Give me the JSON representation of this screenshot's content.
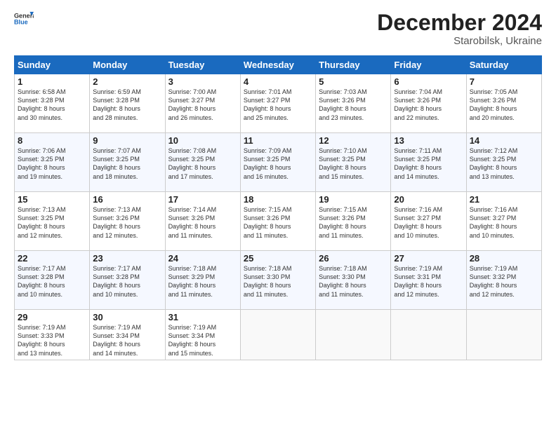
{
  "header": {
    "logo_general": "General",
    "logo_blue": "Blue",
    "month_title": "December 2024",
    "location": "Starobilsk, Ukraine"
  },
  "weekdays": [
    "Sunday",
    "Monday",
    "Tuesday",
    "Wednesday",
    "Thursday",
    "Friday",
    "Saturday"
  ],
  "rows": [
    [
      {
        "day": "1",
        "lines": [
          "Sunrise: 6:58 AM",
          "Sunset: 3:28 PM",
          "Daylight: 8 hours",
          "and 30 minutes."
        ]
      },
      {
        "day": "2",
        "lines": [
          "Sunrise: 6:59 AM",
          "Sunset: 3:28 PM",
          "Daylight: 8 hours",
          "and 28 minutes."
        ]
      },
      {
        "day": "3",
        "lines": [
          "Sunrise: 7:00 AM",
          "Sunset: 3:27 PM",
          "Daylight: 8 hours",
          "and 26 minutes."
        ]
      },
      {
        "day": "4",
        "lines": [
          "Sunrise: 7:01 AM",
          "Sunset: 3:27 PM",
          "Daylight: 8 hours",
          "and 25 minutes."
        ]
      },
      {
        "day": "5",
        "lines": [
          "Sunrise: 7:03 AM",
          "Sunset: 3:26 PM",
          "Daylight: 8 hours",
          "and 23 minutes."
        ]
      },
      {
        "day": "6",
        "lines": [
          "Sunrise: 7:04 AM",
          "Sunset: 3:26 PM",
          "Daylight: 8 hours",
          "and 22 minutes."
        ]
      },
      {
        "day": "7",
        "lines": [
          "Sunrise: 7:05 AM",
          "Sunset: 3:26 PM",
          "Daylight: 8 hours",
          "and 20 minutes."
        ]
      }
    ],
    [
      {
        "day": "8",
        "lines": [
          "Sunrise: 7:06 AM",
          "Sunset: 3:25 PM",
          "Daylight: 8 hours",
          "and 19 minutes."
        ]
      },
      {
        "day": "9",
        "lines": [
          "Sunrise: 7:07 AM",
          "Sunset: 3:25 PM",
          "Daylight: 8 hours",
          "and 18 minutes."
        ]
      },
      {
        "day": "10",
        "lines": [
          "Sunrise: 7:08 AM",
          "Sunset: 3:25 PM",
          "Daylight: 8 hours",
          "and 17 minutes."
        ]
      },
      {
        "day": "11",
        "lines": [
          "Sunrise: 7:09 AM",
          "Sunset: 3:25 PM",
          "Daylight: 8 hours",
          "and 16 minutes."
        ]
      },
      {
        "day": "12",
        "lines": [
          "Sunrise: 7:10 AM",
          "Sunset: 3:25 PM",
          "Daylight: 8 hours",
          "and 15 minutes."
        ]
      },
      {
        "day": "13",
        "lines": [
          "Sunrise: 7:11 AM",
          "Sunset: 3:25 PM",
          "Daylight: 8 hours",
          "and 14 minutes."
        ]
      },
      {
        "day": "14",
        "lines": [
          "Sunrise: 7:12 AM",
          "Sunset: 3:25 PM",
          "Daylight: 8 hours",
          "and 13 minutes."
        ]
      }
    ],
    [
      {
        "day": "15",
        "lines": [
          "Sunrise: 7:13 AM",
          "Sunset: 3:25 PM",
          "Daylight: 8 hours",
          "and 12 minutes."
        ]
      },
      {
        "day": "16",
        "lines": [
          "Sunrise: 7:13 AM",
          "Sunset: 3:26 PM",
          "Daylight: 8 hours",
          "and 12 minutes."
        ]
      },
      {
        "day": "17",
        "lines": [
          "Sunrise: 7:14 AM",
          "Sunset: 3:26 PM",
          "Daylight: 8 hours",
          "and 11 minutes."
        ]
      },
      {
        "day": "18",
        "lines": [
          "Sunrise: 7:15 AM",
          "Sunset: 3:26 PM",
          "Daylight: 8 hours",
          "and 11 minutes."
        ]
      },
      {
        "day": "19",
        "lines": [
          "Sunrise: 7:15 AM",
          "Sunset: 3:26 PM",
          "Daylight: 8 hours",
          "and 11 minutes."
        ]
      },
      {
        "day": "20",
        "lines": [
          "Sunrise: 7:16 AM",
          "Sunset: 3:27 PM",
          "Daylight: 8 hours",
          "and 10 minutes."
        ]
      },
      {
        "day": "21",
        "lines": [
          "Sunrise: 7:16 AM",
          "Sunset: 3:27 PM",
          "Daylight: 8 hours",
          "and 10 minutes."
        ]
      }
    ],
    [
      {
        "day": "22",
        "lines": [
          "Sunrise: 7:17 AM",
          "Sunset: 3:28 PM",
          "Daylight: 8 hours",
          "and 10 minutes."
        ]
      },
      {
        "day": "23",
        "lines": [
          "Sunrise: 7:17 AM",
          "Sunset: 3:28 PM",
          "Daylight: 8 hours",
          "and 10 minutes."
        ]
      },
      {
        "day": "24",
        "lines": [
          "Sunrise: 7:18 AM",
          "Sunset: 3:29 PM",
          "Daylight: 8 hours",
          "and 11 minutes."
        ]
      },
      {
        "day": "25",
        "lines": [
          "Sunrise: 7:18 AM",
          "Sunset: 3:30 PM",
          "Daylight: 8 hours",
          "and 11 minutes."
        ]
      },
      {
        "day": "26",
        "lines": [
          "Sunrise: 7:18 AM",
          "Sunset: 3:30 PM",
          "Daylight: 8 hours",
          "and 11 minutes."
        ]
      },
      {
        "day": "27",
        "lines": [
          "Sunrise: 7:19 AM",
          "Sunset: 3:31 PM",
          "Daylight: 8 hours",
          "and 12 minutes."
        ]
      },
      {
        "day": "28",
        "lines": [
          "Sunrise: 7:19 AM",
          "Sunset: 3:32 PM",
          "Daylight: 8 hours",
          "and 12 minutes."
        ]
      }
    ],
    [
      {
        "day": "29",
        "lines": [
          "Sunrise: 7:19 AM",
          "Sunset: 3:33 PM",
          "Daylight: 8 hours",
          "and 13 minutes."
        ]
      },
      {
        "day": "30",
        "lines": [
          "Sunrise: 7:19 AM",
          "Sunset: 3:34 PM",
          "Daylight: 8 hours",
          "and 14 minutes."
        ]
      },
      {
        "day": "31",
        "lines": [
          "Sunrise: 7:19 AM",
          "Sunset: 3:34 PM",
          "Daylight: 8 hours",
          "and 15 minutes."
        ]
      },
      null,
      null,
      null,
      null
    ]
  ]
}
